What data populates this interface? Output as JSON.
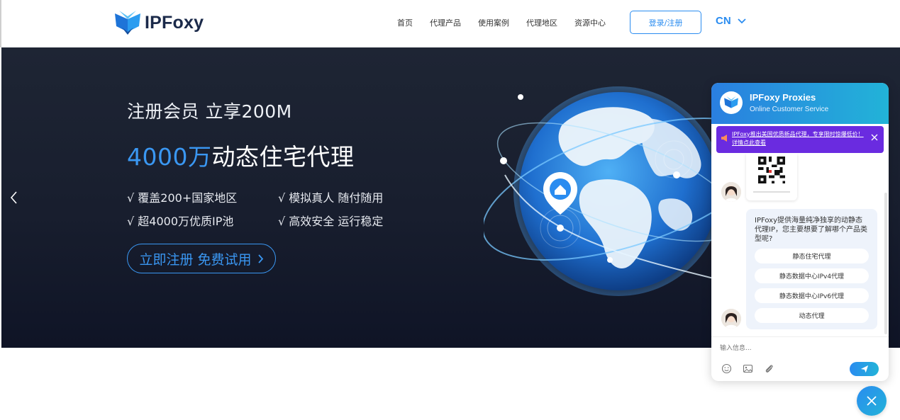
{
  "header": {
    "logo_text": "IPFoxy",
    "nav": [
      "首页",
      "代理产品",
      "使用案例",
      "代理地区",
      "资源中心"
    ],
    "login_label": "登录/注册",
    "lang": "CN"
  },
  "hero": {
    "subtitle": "注册会员 立享200M",
    "title_highlight": "4000万",
    "title_rest": "动态住宅代理",
    "features": [
      "√ 覆盖200+国家地区",
      "√ 模拟真人 随付随用",
      "√ 超4000万优质IP池",
      "√ 高效安全 运行稳定"
    ],
    "cta_label": "立即注册 免费试用"
  },
  "chat": {
    "title": "IPFoxy Proxies",
    "subtitle": "Online Customer Service",
    "notice": "IPFoxy推出美国优质新品代理，专享限时惊爆低价！详情点此查看",
    "bubble_text": "IPFoxy提供海量纯净独享的动静态代理IP，您主要想要了解哪个产品类型呢?",
    "options": [
      "静态住宅代理",
      "静态数据中心IPv4代理",
      "静态数据中心IPv6代理",
      "动态代理"
    ],
    "input_placeholder": "输入信息..."
  },
  "colors": {
    "accent": "#2a8cf0",
    "hero_bg": "#181e2e",
    "notice_bg": "#6a2be0",
    "chat_gradient_end": "#22b3d8"
  },
  "icons": [
    "logo-icon",
    "chevron-down-icon",
    "chevron-left-icon",
    "chevron-right-icon",
    "chat-logo-icon",
    "megaphone-icon",
    "close-icon",
    "emoji-icon",
    "image-icon",
    "attachment-icon",
    "send-icon",
    "close-chat-icon"
  ]
}
